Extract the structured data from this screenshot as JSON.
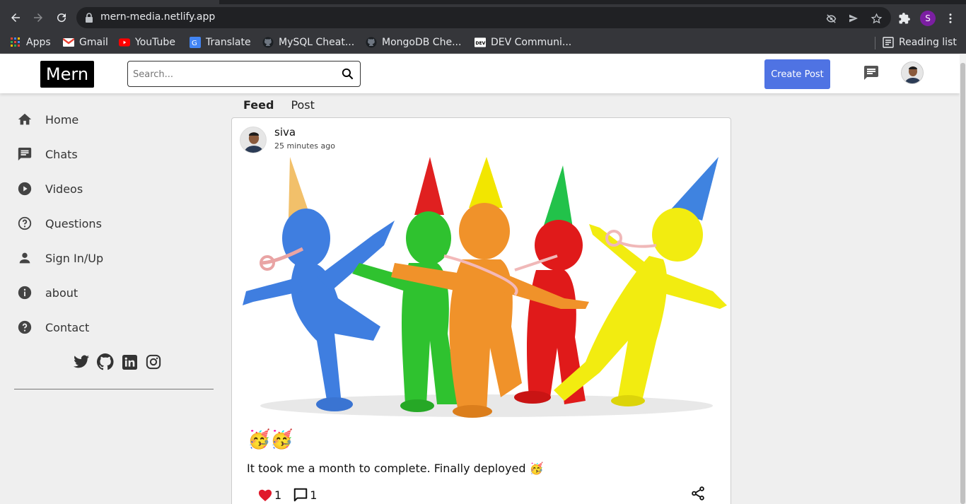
{
  "browser": {
    "url": "mern-media.netlify.app",
    "profile_initial": "S",
    "bookmarks": [
      {
        "label": "Apps",
        "icon": "apps-grid-icon"
      },
      {
        "label": "Gmail",
        "icon": "gmail-icon"
      },
      {
        "label": "YouTube",
        "icon": "youtube-icon"
      },
      {
        "label": "Translate",
        "icon": "translate-icon"
      },
      {
        "label": "MySQL Cheat...",
        "icon": "github-icon"
      },
      {
        "label": "MongoDB Che...",
        "icon": "github-icon"
      },
      {
        "label": "DEV Communi...",
        "icon": "dev-icon"
      }
    ],
    "reading_list": "Reading list"
  },
  "header": {
    "logo": "Mern",
    "search_placeholder": "Search...",
    "create_post": "Create Post",
    "accent_color": "#4f73e3"
  },
  "sidebar": {
    "items": [
      {
        "label": "Home",
        "icon": "home-icon"
      },
      {
        "label": "Chats",
        "icon": "chat-icon"
      },
      {
        "label": "Videos",
        "icon": "play-circle-icon"
      },
      {
        "label": "Questions",
        "icon": "help-circle-icon"
      },
      {
        "label": "Sign In/Up",
        "icon": "person-icon"
      },
      {
        "label": "about",
        "icon": "info-icon"
      },
      {
        "label": "Contact",
        "icon": "help-icon"
      }
    ],
    "socials": [
      "twitter-icon",
      "github-icon",
      "linkedin-icon",
      "instagram-icon"
    ]
  },
  "feed": {
    "tabs": [
      {
        "label": "Feed",
        "active": true
      },
      {
        "label": "Post",
        "active": false
      }
    ],
    "post": {
      "author": "siva",
      "time": "25 minutes ago",
      "title": "🥳🥳",
      "text": "It took me a month to complete. Finally deployed 🥳",
      "likes": "1",
      "comments": "1",
      "like_color": "#e0192b"
    }
  }
}
